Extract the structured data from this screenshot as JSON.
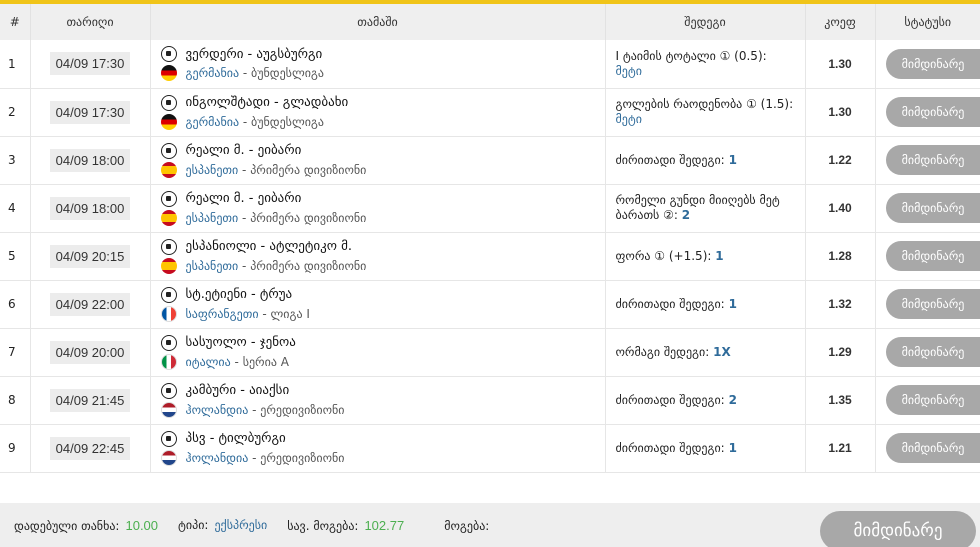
{
  "headers": {
    "num": "#",
    "date": "თარიღი",
    "match": "თამაში",
    "result": "შედეგი",
    "odds": "კოეფ",
    "status": "სტატუსი"
  },
  "rows": [
    {
      "n": "1",
      "date": "04/09 17:30",
      "teams": "ვერდერი - აუგსბურგი",
      "country": "გერმანია",
      "league": " - ბუნდესლიგა",
      "flag": "de",
      "market": "I ტაიმის ტოტალი ① (0.5):",
      "pick": "მეტი",
      "odds": "1.30",
      "status": "მიმდინარე"
    },
    {
      "n": "2",
      "date": "04/09 17:30",
      "teams": "ინგოლშტადი - გლადბახი",
      "country": "გერმანია",
      "league": " - ბუნდესლიგა",
      "flag": "de",
      "market": "გოლების რაოდენობა ① (1.5):",
      "pick": "მეტი",
      "odds": "1.30",
      "status": "მიმდინარე"
    },
    {
      "n": "3",
      "date": "04/09 18:00",
      "teams": "რეალი მ. - ეიბარი",
      "country": "ესპანეთი",
      "league": " - პრიმერა დივიზიონი",
      "flag": "es",
      "market": "ძირითადი შედეგი:",
      "pick": "1",
      "odds": "1.22",
      "status": "მიმდინარე"
    },
    {
      "n": "4",
      "date": "04/09 18:00",
      "teams": "რეალი მ. - ეიბარი",
      "country": "ესპანეთი",
      "league": " - პრიმერა დივიზიონი",
      "flag": "es",
      "market": "რომელი გუნდი მიიღებს მეტ ბარათს ②:",
      "pick": "2",
      "odds": "1.40",
      "status": "მიმდინარე"
    },
    {
      "n": "5",
      "date": "04/09 20:15",
      "teams": "ესპანიოლი - ატლეტიკო მ.",
      "country": "ესპანეთი",
      "league": " - პრიმერა დივიზიონი",
      "flag": "es",
      "market": "ფორა ① (+1.5):",
      "pick": "1",
      "odds": "1.28",
      "status": "მიმდინარე"
    },
    {
      "n": "6",
      "date": "04/09 22:00",
      "teams": "სტ.ეტიენი - ტრუა",
      "country": "საფრანგეთი",
      "league": " - ლიგა I",
      "flag": "fr",
      "market": "ძირითადი შედეგი:",
      "pick": "1",
      "odds": "1.32",
      "status": "მიმდინარე"
    },
    {
      "n": "7",
      "date": "04/09 20:00",
      "teams": "სასუოლო - ჯენოა",
      "country": "იტალია",
      "league": " - სერია A",
      "flag": "it",
      "market": "ორმაგი შედეგი:",
      "pick": "1X",
      "odds": "1.29",
      "status": "მიმდინარე"
    },
    {
      "n": "8",
      "date": "04/09 21:45",
      "teams": "კამბური - აიაქსი",
      "country": "ჰოლანდია",
      "league": " - ერედივიზიონი",
      "flag": "nl",
      "market": "ძირითადი შედეგი:",
      "pick": "2",
      "odds": "1.35",
      "status": "მიმდინარე"
    },
    {
      "n": "9",
      "date": "04/09 22:45",
      "teams": "პსვ - ტილბურგი",
      "country": "ჰოლანდია",
      "league": " - ერედივიზიონი",
      "flag": "nl",
      "market": "ძირითადი შედეგი:",
      "pick": "1",
      "odds": "1.21",
      "status": "მიმდინარე"
    }
  ],
  "footer": {
    "stake_label": "დადებული თანხა:",
    "stake_value": "10.00",
    "type_label": "ტიპი:",
    "type_value": "ექსპრესი",
    "possible_label": "სავ. მოგება:",
    "possible_value": "102.77",
    "win_label": "მოგება:",
    "win_value": "",
    "status_button": "მიმდინარე"
  },
  "colors": {
    "accent_bar": "#f0c419",
    "pick_blue": "#2f6b9a",
    "value_green": "#4caf50",
    "status_gray": "#a8a8a8"
  }
}
